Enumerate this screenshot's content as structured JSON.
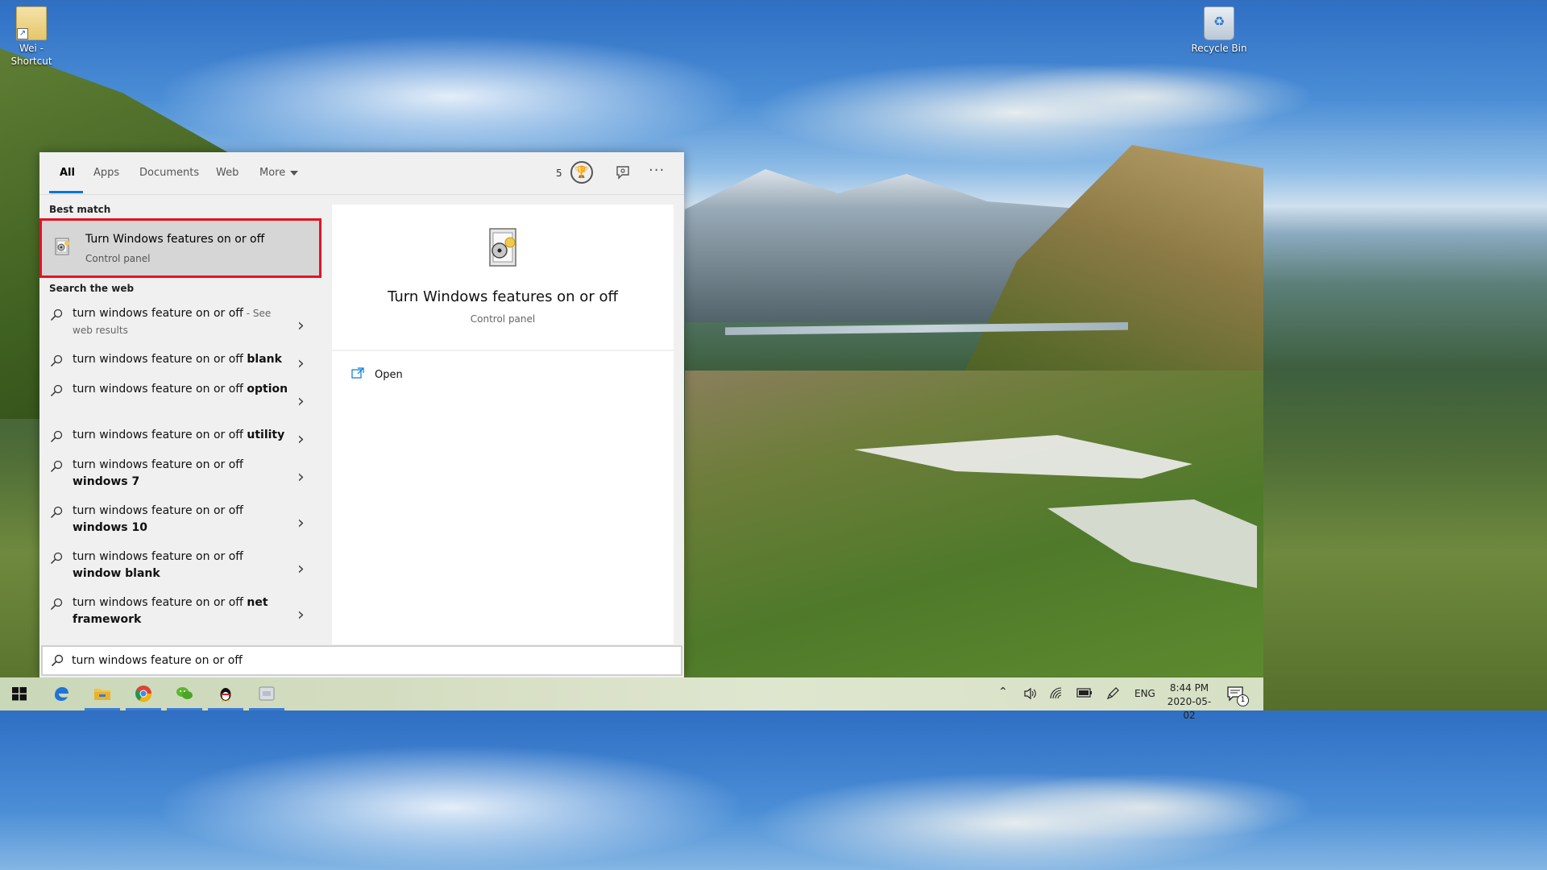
{
  "desktop": {
    "icons": [
      {
        "label_line1": "Wei -",
        "label_line2": "Shortcut",
        "icon": "folder-shortcut-icon"
      },
      {
        "label_line1": "Recycle Bin",
        "icon": "recycle-bin-icon"
      }
    ]
  },
  "search": {
    "tabs": [
      {
        "label": "All",
        "active": true
      },
      {
        "label": "Apps"
      },
      {
        "label": "Documents"
      },
      {
        "label": "Web"
      },
      {
        "label": "More"
      }
    ],
    "rewards_count": "5",
    "best_match": {
      "heading": "Best match",
      "title": "Turn Windows features on or off",
      "subtitle": "Control panel"
    },
    "web_heading": "Search the web",
    "web_results": [
      {
        "normal": "turn windows feature on or off",
        "dim": " - See web results",
        "bold": ""
      },
      {
        "normal": "turn windows feature on or off ",
        "bold": "blank"
      },
      {
        "normal": "turn windows feature on or off ",
        "bold": "option"
      },
      {
        "normal": "turn windows feature on or off ",
        "bold": "utility"
      },
      {
        "normal": "turn windows feature on or off ",
        "bold": "windows 7"
      },
      {
        "normal": "turn windows feature on or off ",
        "bold": "windows 10"
      },
      {
        "normal": "turn windows feature on or off ",
        "bold": "window blank"
      },
      {
        "normal": "turn windows feature on or off ",
        "bold": "net framework"
      }
    ],
    "preview": {
      "title": "Turn Windows features on or off",
      "subtitle": "Control panel",
      "actions": [
        {
          "label": "Open",
          "icon": "open-icon"
        }
      ]
    },
    "query": "turn windows feature on or off"
  },
  "taskbar": {
    "apps": [
      "start-icon",
      "edge-icon",
      "file-explorer-icon",
      "chrome-icon",
      "wechat-icon",
      "qq-icon",
      "app-window-icon"
    ],
    "language": "ENG",
    "time": "8:44 PM",
    "date": "2020-05-02",
    "notification_count": "1"
  },
  "colors": {
    "accent": "#0078d7",
    "highlight_border": "#e81123",
    "panel_bg": "#f0f0f0"
  }
}
